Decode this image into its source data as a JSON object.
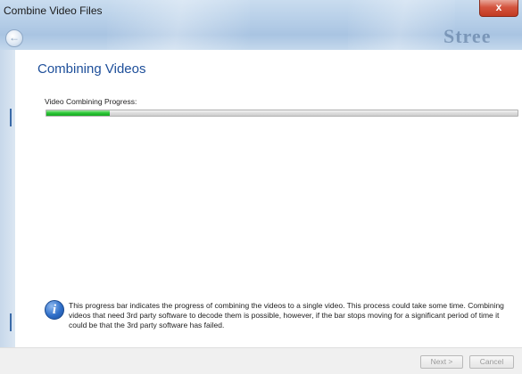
{
  "window": {
    "title": "Combine Video Files",
    "close_label": "x",
    "background_word": "Stree"
  },
  "page": {
    "title": "Combining Videos"
  },
  "progress": {
    "label": "Video Combining Progress:",
    "fraction": 0.135,
    "fill_color": "#2fc83a"
  },
  "info": {
    "icon": "info-icon",
    "icon_glyph": "i",
    "text": "This progress bar indicates the progress of combining the videos to a single video.  This process could take some time.  Combining videos that need 3rd party software to decode them is possible, however, if the bar stops moving for a significant period of time it could be that the 3rd party software has failed."
  },
  "footer": {
    "next_label": "Next >",
    "cancel_label": "Cancel"
  },
  "colors": {
    "title_blue": "#1e4f9a",
    "close_red": "#c23a22"
  }
}
